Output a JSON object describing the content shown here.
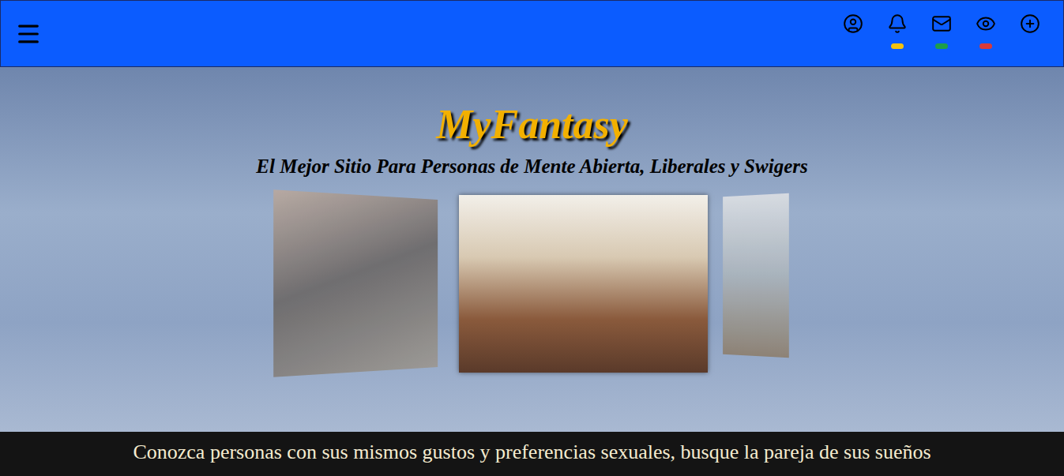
{
  "header": {
    "nav_icons": [
      {
        "indicator": false
      },
      {
        "indicator": true,
        "color": "#f4c20d"
      },
      {
        "indicator": true,
        "color": "#1e9e4a"
      },
      {
        "indicator": true,
        "color": "#d93a3a"
      },
      {
        "indicator": false
      }
    ]
  },
  "hero": {
    "title": "MyFantasy",
    "subtitle": "El Mejor Sitio Para Personas de Mente Abierta, Liberales y Swigers"
  },
  "carousel": {
    "slides": [
      {
        "selected": false
      },
      {
        "selected": true
      },
      {
        "selected": false
      }
    ]
  },
  "banner": {
    "text": "Conozca personas con sus mismos gustos y preferencias sexuales, busque la pareja de sus sueños"
  }
}
